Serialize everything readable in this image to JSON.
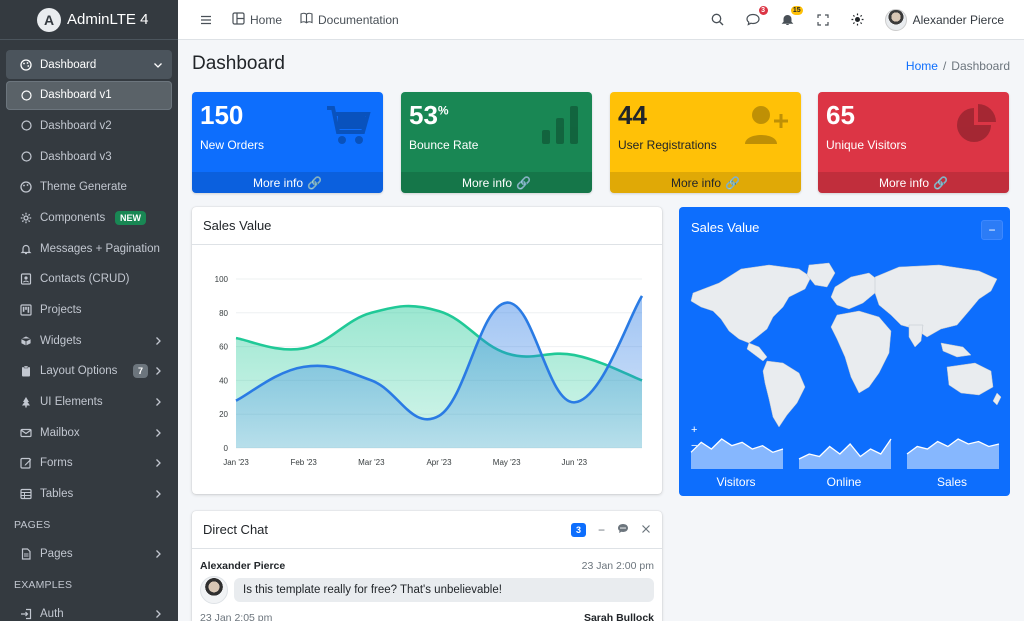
{
  "brand": {
    "name": "AdminLTE 4",
    "logo_letter": "A"
  },
  "sidebar": {
    "items": [
      {
        "label": "Dashboard",
        "icon": "palette-icon"
      },
      {
        "label": "Dashboard v1",
        "icon": "circle-icon"
      },
      {
        "label": "Dashboard v2",
        "icon": "circle-icon"
      },
      {
        "label": "Dashboard v3",
        "icon": "circle-icon"
      },
      {
        "label": "Theme Generate",
        "icon": "palette-icon"
      },
      {
        "label": "Components",
        "icon": "gear-icon",
        "badge": "NEW"
      },
      {
        "label": "Messages + Pagination",
        "icon": "bell-icon"
      },
      {
        "label": "Contacts (CRUD)",
        "icon": "contact-icon"
      },
      {
        "label": "Projects",
        "icon": "kanban-icon"
      },
      {
        "label": "Widgets",
        "icon": "box-icon"
      },
      {
        "label": "Layout Options",
        "icon": "clipboard-icon",
        "badge": "7"
      },
      {
        "label": "UI Elements",
        "icon": "tree-icon"
      },
      {
        "label": "Mailbox",
        "icon": "mail-icon"
      },
      {
        "label": "Forms",
        "icon": "pencil-icon"
      },
      {
        "label": "Tables",
        "icon": "table-icon"
      }
    ],
    "header_pages": "PAGES",
    "pages_item": "Pages",
    "header_examples": "EXAMPLES",
    "auth_item": "Auth"
  },
  "topbar": {
    "menu_icon": "hamburger-icon",
    "home": "Home",
    "documentation": "Documentation",
    "messages_badge": "3",
    "notifications_badge": "15",
    "user_name": "Alexander Pierce"
  },
  "page": {
    "title": "Dashboard",
    "breadcrumb_home": "Home",
    "breadcrumb_sep": "/",
    "breadcrumb_current": "Dashboard"
  },
  "small_boxes": [
    {
      "value": "150",
      "suffix": "",
      "label": "New Orders",
      "footer": "More info",
      "color": "#0d6efd",
      "icon": "cart-icon"
    },
    {
      "value": "53",
      "suffix": "%",
      "label": "Bounce Rate",
      "footer": "More info",
      "color": "#198754",
      "icon": "bar-chart-icon"
    },
    {
      "value": "44",
      "suffix": "",
      "label": "User Registrations",
      "footer": "More info",
      "color": "#ffc107",
      "icon": "user-plus-icon"
    },
    {
      "value": "65",
      "suffix": "",
      "label": "Unique Visitors",
      "footer": "More info",
      "color": "#dc3545",
      "icon": "pie-chart-icon"
    }
  ],
  "sales_chart": {
    "title": "Sales Value"
  },
  "chart_data": {
    "type": "area",
    "categories": [
      "Jan '23",
      "Feb '23",
      "Mar '23",
      "Apr '23",
      "May '23",
      "Jun '23",
      ""
    ],
    "series": [
      {
        "color": "#20c997",
        "values": [
          65,
          59,
          80,
          81,
          56,
          55,
          40
        ]
      },
      {
        "color": "#2a7be4",
        "values": [
          28,
          48,
          40,
          19,
          86,
          27,
          90
        ]
      }
    ],
    "ylim": [
      0,
      100
    ],
    "yticks": [
      0,
      20,
      40,
      60,
      80,
      100
    ],
    "grid": true
  },
  "map_card": {
    "title": "Sales Value",
    "collapse_label": "−",
    "zoom_in": "+",
    "zoom_out": "−",
    "sparklines": [
      {
        "label": "Visitors",
        "values": [
          5,
          8,
          6,
          9,
          7,
          8,
          6,
          7,
          5,
          6
        ]
      },
      {
        "label": "Online",
        "values": [
          4,
          6,
          5,
          9,
          6,
          10,
          5,
          8,
          6,
          12
        ]
      },
      {
        "label": "Sales",
        "values": [
          6,
          9,
          8,
          11,
          9,
          12,
          10,
          11,
          9,
          10
        ]
      }
    ]
  },
  "chat": {
    "title": "Direct Chat",
    "badge": "3",
    "messages": [
      {
        "name": "Alexander Pierce",
        "time": "23 Jan 2:00 pm",
        "text": "Is this template really for free? That's unbelievable!"
      },
      {
        "name": "Sarah Bullock",
        "time": "23 Jan 2:05 pm"
      }
    ]
  }
}
